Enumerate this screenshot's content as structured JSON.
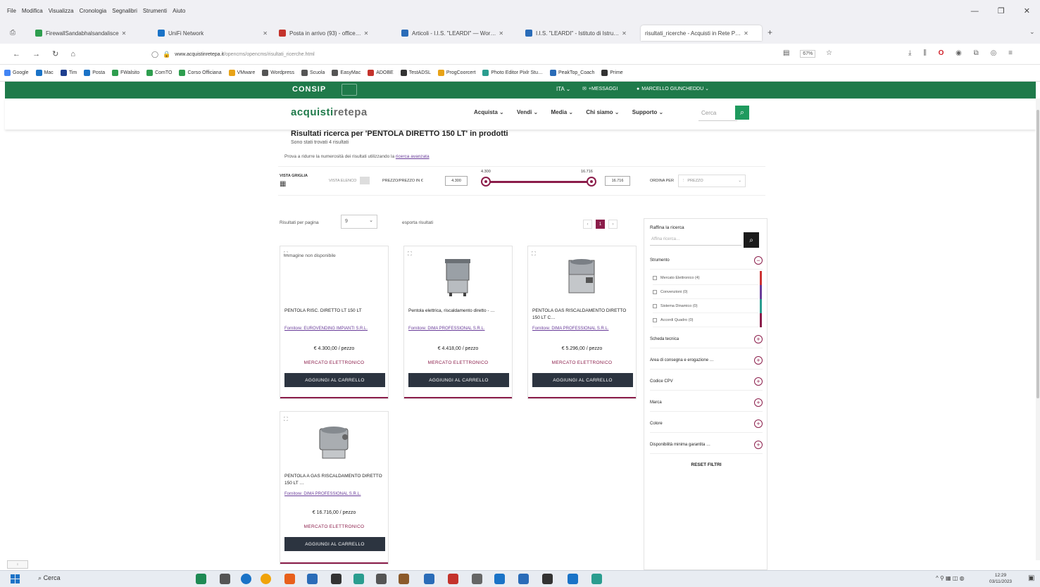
{
  "browser": {
    "menus": [
      "File",
      "Modifica",
      "Visualizza",
      "Cronologia",
      "Segnalibri",
      "Strumenti",
      "Aiuto"
    ],
    "tabs": [
      {
        "title": "FirewallSandabhalsandalisce",
        "color": "#2e9e4f"
      },
      {
        "title": "UniFi Network",
        "color": "#1a73c7"
      },
      {
        "title": "Posta in arrivo (93) - office…",
        "color": "#c4332c"
      },
      {
        "title": "Articoli - I.I.S. \"LEARDI\" — Wor…",
        "color": "#2a6cb8"
      },
      {
        "title": "I.I.S. \"LEARDI\" - Istituto di Istru…",
        "color": "#2a6cb8"
      },
      {
        "title": "risultati_ricerche - Acquisti in Rete P…",
        "color": "#ffffff"
      }
    ],
    "url_host": "www.acquistinretepa.it",
    "url_path": "/opencms/opencms/risultati_ricerche.html",
    "zoom": "67%",
    "bookmarks": [
      {
        "label": "Google",
        "color": "#4285f4"
      },
      {
        "label": "Mac",
        "color": "#1a73c7"
      },
      {
        "label": "Tim",
        "color": "#1e3f8f"
      },
      {
        "label": "Posta",
        "color": "#1a73c7"
      },
      {
        "label": "FWalsito",
        "color": "#2e9e4f"
      },
      {
        "label": "ComTO",
        "color": "#2e9e4f"
      },
      {
        "label": "Corso Officiana",
        "color": "#2e9e4f"
      },
      {
        "label": "VMware",
        "color": "#e8a317"
      },
      {
        "label": "Wordpress",
        "color": "#555555"
      },
      {
        "label": "Scuola",
        "color": "#555555"
      },
      {
        "label": "EasyMac",
        "color": "#555555"
      },
      {
        "label": "ADOBE",
        "color": "#c4332c"
      },
      {
        "label": "TestADSL",
        "color": "#333333"
      },
      {
        "label": "ProgCoorcert",
        "color": "#e8a317"
      },
      {
        "label": "Photo Editor Pixlr Stu…",
        "color": "#2a9d8f"
      },
      {
        "label": "PeakTop_Coach",
        "color": "#2a6cb8"
      },
      {
        "label": "Prime",
        "color": "#333333"
      }
    ]
  },
  "site": {
    "consip_logo": "CONSIP",
    "lang": "ITA",
    "user_box": "+MESSAGGI",
    "user_name": "MARCELLO GIUNCHEDDU",
    "logo_main": "acquisti",
    "logo_rete": "retepa",
    "nav": [
      "Acquista",
      "Vendi",
      "Media",
      "Chi siamo",
      "Supporto"
    ],
    "search_placeholder": "Cerca"
  },
  "results": {
    "title": "Risultati ricerca per 'PENTOLA DIRETTO 150 LT' in prodotti",
    "count": "Sono stati trovati 4 risultati",
    "refine_hint": "Prova a ridurre la numerosità dei risultati utilizzando la",
    "refine_link": "ricerca avanzata",
    "view_label": "VISTA GRIGLIA",
    "view_list": "VISTA ELENCO",
    "price_label": "PREZZO/PREZZO IN €",
    "price_min": "4.300",
    "price_max": "16.716",
    "sort_label": "ORDINA PER",
    "sort_value": "PREZZO",
    "per_page_label": "Risultati per pagina",
    "per_page_value": "9",
    "export_label": "esporta risultati",
    "current_page": "1"
  },
  "products": [
    {
      "name": "PENTOLA RISC. DIRETTO LT 150 LT",
      "supplier": "Fornitore: EUROVENDING IMPIANTI S.R.L.",
      "price": "€ 4.300,00 / pezzo",
      "market": "MERCATO ELETTRONICO",
      "cart": "AGGIUNGI AL CARRELLO",
      "noimg": "Immagine non disponibile"
    },
    {
      "name": "Pentola elettrica, riscaldamento diretto - …",
      "supplier": "Fornitore: DIMA PROFESSIONAL S.R.L.",
      "price": "€ 4.418,00 / pezzo",
      "market": "MERCATO ELETTRONICO",
      "cart": "AGGIUNGI AL CARRELLO"
    },
    {
      "name": "PENTOLA GAS RISCALDAMENTO DIRETTO 150 LT C…",
      "supplier": "Fornitore: DIMA PROFESSIONAL S.R.L.",
      "price": "€ 5.296,00 / pezzo",
      "market": "MERCATO ELETTRONICO",
      "cart": "AGGIUNGI AL CARRELLO"
    },
    {
      "name": "PENTOLA A GAS RISCALDAMENTO DIRETTO 150 LT …",
      "supplier": "Fornitore: DIMA PROFESSIONAL S.R.L.",
      "price": "€ 16.716,00 / pezzo",
      "market": "MERCATO ELETTRONICO",
      "cart": "AGGIUNGI AL CARRELLO"
    }
  ],
  "sidebar": {
    "title": "Raffina la ricerca",
    "search_placeholder": "Affina ricerca…",
    "facets": [
      "Strumento",
      "Scheda tecnica",
      "Area di consegna e erogazione …",
      "Codice CPV",
      "Marca",
      "Colore",
      "Disponibilità minima garantita …"
    ],
    "sub_facets": [
      "Mercato Elettronico (4)",
      "Convenzioni (0)",
      "Sistema Dinamico (0)",
      "Accordi Quadro (0)"
    ],
    "reset": "RESET FILTRI"
  },
  "taskbar": {
    "search": "Cerca",
    "time": "12:29",
    "date": "03/11/2023"
  }
}
